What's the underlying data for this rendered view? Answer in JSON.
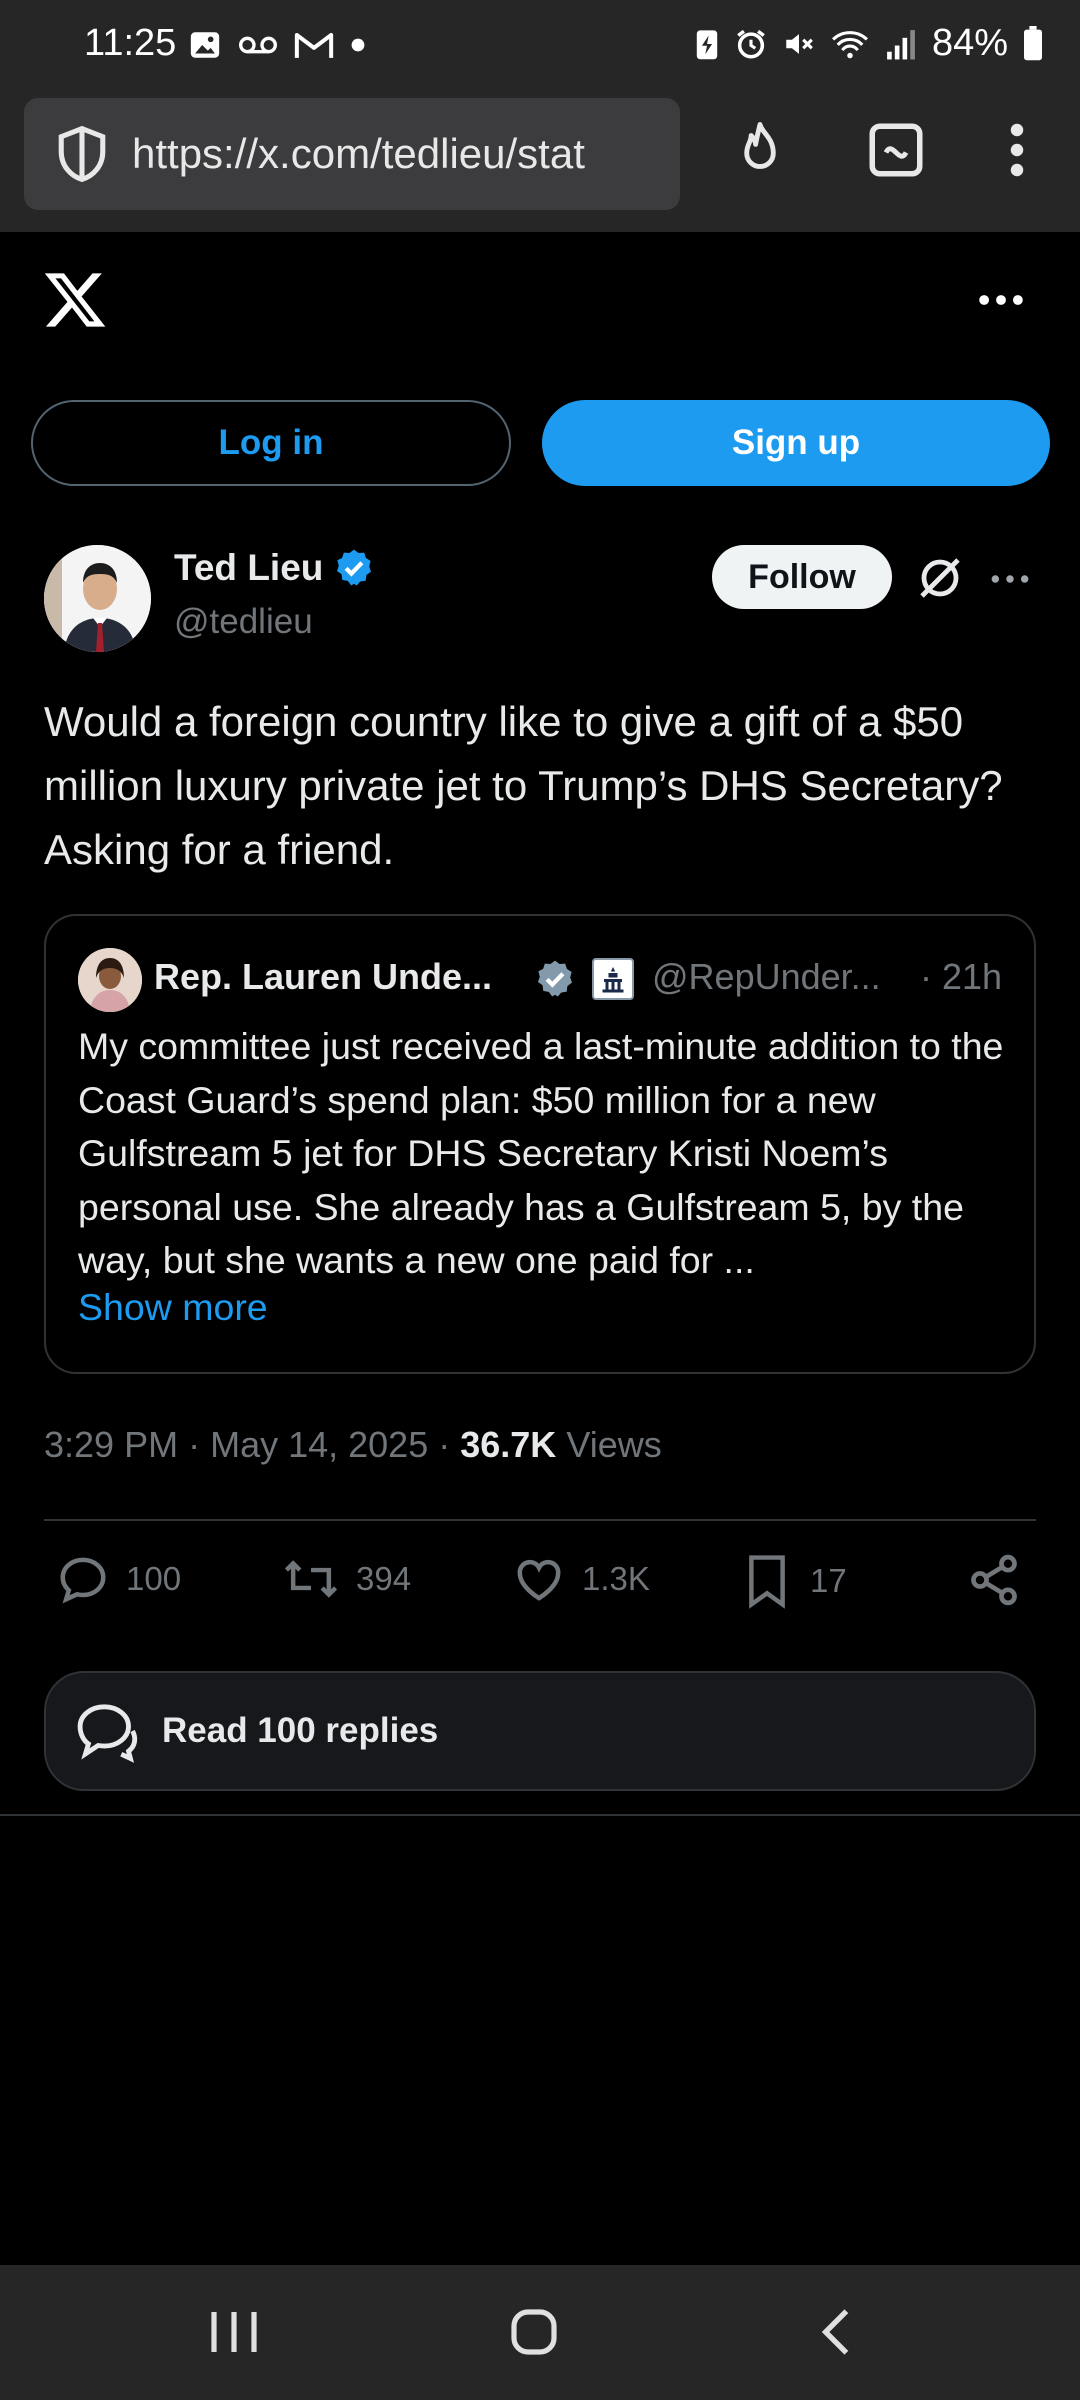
{
  "status_bar": {
    "time": "11:25",
    "battery": "84%",
    "icons_left": [
      "image-icon",
      "voicemail-icon",
      "gmail-icon",
      "dot-icon"
    ],
    "icons_right": [
      "battery-saver-icon",
      "alarm-icon",
      "mute-icon",
      "wifi-icon",
      "signal-icon",
      "battery-icon"
    ]
  },
  "browser": {
    "url": "https://x.com/tedlieu/stat",
    "icons": [
      "shield-icon",
      "flame-icon",
      "tabs-icon",
      "overflow-icon"
    ]
  },
  "header": {
    "login_label": "Log in",
    "signup_label": "Sign up"
  },
  "tweet": {
    "author_name": "Ted Lieu",
    "author_handle": "@tedlieu",
    "follow_label": "Follow",
    "text": "Would a foreign country like to give a gift of a $50 million luxury private jet to Trump’s DHS Secretary? Asking for a friend.",
    "time": "3:29 PM",
    "date": "May 14, 2025",
    "views_count": "36.7K",
    "views_label": "Views"
  },
  "quote": {
    "author_name": "Rep. Lauren Unde...",
    "author_handle": "@RepUnder...",
    "time": "· 21h",
    "text": "My committee just received a last-minute addition to the Coast Guard’s spend plan: $50 million for a new Gulfstream 5 jet for DHS Secretary Kristi Noem’s personal use. She already has a Gulfstream 5, by the way, but she wants a new one paid for ...",
    "show_more": "Show more"
  },
  "actions": {
    "replies": "100",
    "reposts": "394",
    "likes": "1.3K",
    "bookmarks": "17"
  },
  "read_replies_label": "Read 100 replies",
  "colors": {
    "accent": "#1d9bf0",
    "background": "#000000",
    "muted": "#71767b",
    "border": "#2f3336"
  }
}
